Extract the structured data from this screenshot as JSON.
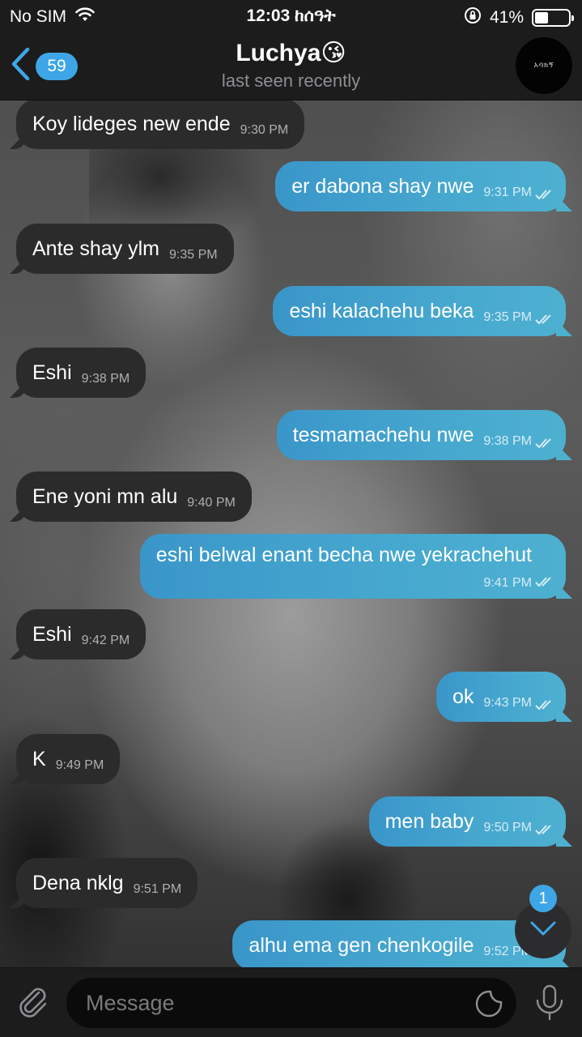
{
  "status_bar": {
    "carrier": "No SIM",
    "time": "12:03 ከሰዓት",
    "battery": "41%",
    "battery_level": 0.41
  },
  "header": {
    "back_count": "59",
    "title": "Luchya😘",
    "subtitle": "last seen recently",
    "avatar_text": "አባክኝ"
  },
  "messages": [
    {
      "dir": "in",
      "text": "Koy lideges new ende",
      "time": "9:30 PM"
    },
    {
      "dir": "out",
      "text": "er dabona shay nwe",
      "time": "9:31 PM"
    },
    {
      "dir": "in",
      "text": "Ante shay ylm",
      "time": "9:35 PM"
    },
    {
      "dir": "out",
      "text": "eshi kalachehu beka",
      "time": "9:35 PM"
    },
    {
      "dir": "in",
      "text": "Eshi",
      "time": "9:38 PM"
    },
    {
      "dir": "out",
      "text": "tesmamachehu nwe",
      "time": "9:38 PM"
    },
    {
      "dir": "in",
      "text": "Ene yoni mn alu",
      "time": "9:40 PM"
    },
    {
      "dir": "out",
      "text": "eshi belwal enant becha nwe yekrachehut",
      "time": "9:41 PM"
    },
    {
      "dir": "in",
      "text": "Eshi",
      "time": "9:42 PM"
    },
    {
      "dir": "out",
      "text": "ok",
      "time": "9:43 PM"
    },
    {
      "dir": "in",
      "text": "K",
      "time": "9:49 PM"
    },
    {
      "dir": "out",
      "text": "men baby",
      "time": "9:50 PM"
    },
    {
      "dir": "in",
      "text": "Dena nklg",
      "time": "9:51 PM"
    },
    {
      "dir": "out",
      "text": "alhu ema gen  chenkogile",
      "time": "9:52 PM"
    }
  ],
  "scroll_down": {
    "unread": "1"
  },
  "composer": {
    "placeholder": "Message"
  },
  "colors": {
    "accent": "#3ea6e6",
    "outgoing_bubble": "#47a8cf",
    "incoming_bubble": "#2b2b2c",
    "bar": "#1c1c1d"
  }
}
